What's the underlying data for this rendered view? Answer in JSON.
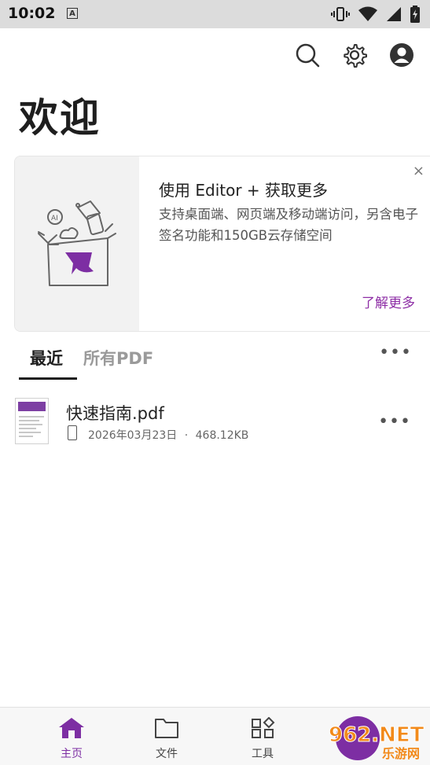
{
  "status_bar": {
    "time": "10:02",
    "a_badge": "A"
  },
  "header": {
    "icons": [
      "search-icon",
      "gear-icon",
      "account-icon"
    ]
  },
  "page_title": "欢迎",
  "promo": {
    "title": "使用 Editor + 获取更多",
    "description": "支持桌面端、网页端及移动端访问，另含电子签名功能和150GB云存储空间",
    "link": "了解更多",
    "close": "×",
    "art_ai_label": "AI"
  },
  "tabs": [
    {
      "label": "最近",
      "active": true
    },
    {
      "label": "所有PDF",
      "active": false
    }
  ],
  "more": "•••",
  "files": [
    {
      "name": "快速指南.pdf",
      "date": "2026年03月23日",
      "separator": "·",
      "size": "468.12KB"
    }
  ],
  "bottom_nav": [
    {
      "label": "主页",
      "icon": "home-icon",
      "active": true
    },
    {
      "label": "文件",
      "icon": "folder-icon",
      "active": false
    },
    {
      "label": "工具",
      "icon": "tools-icon",
      "active": false
    }
  ],
  "watermark": {
    "text": "962.NET",
    "sub": "乐游网"
  },
  "colors": {
    "accent": "#7d2ea3",
    "status_bar": "#dcdcdc",
    "promo_art_bg": "#f2f2f2"
  }
}
